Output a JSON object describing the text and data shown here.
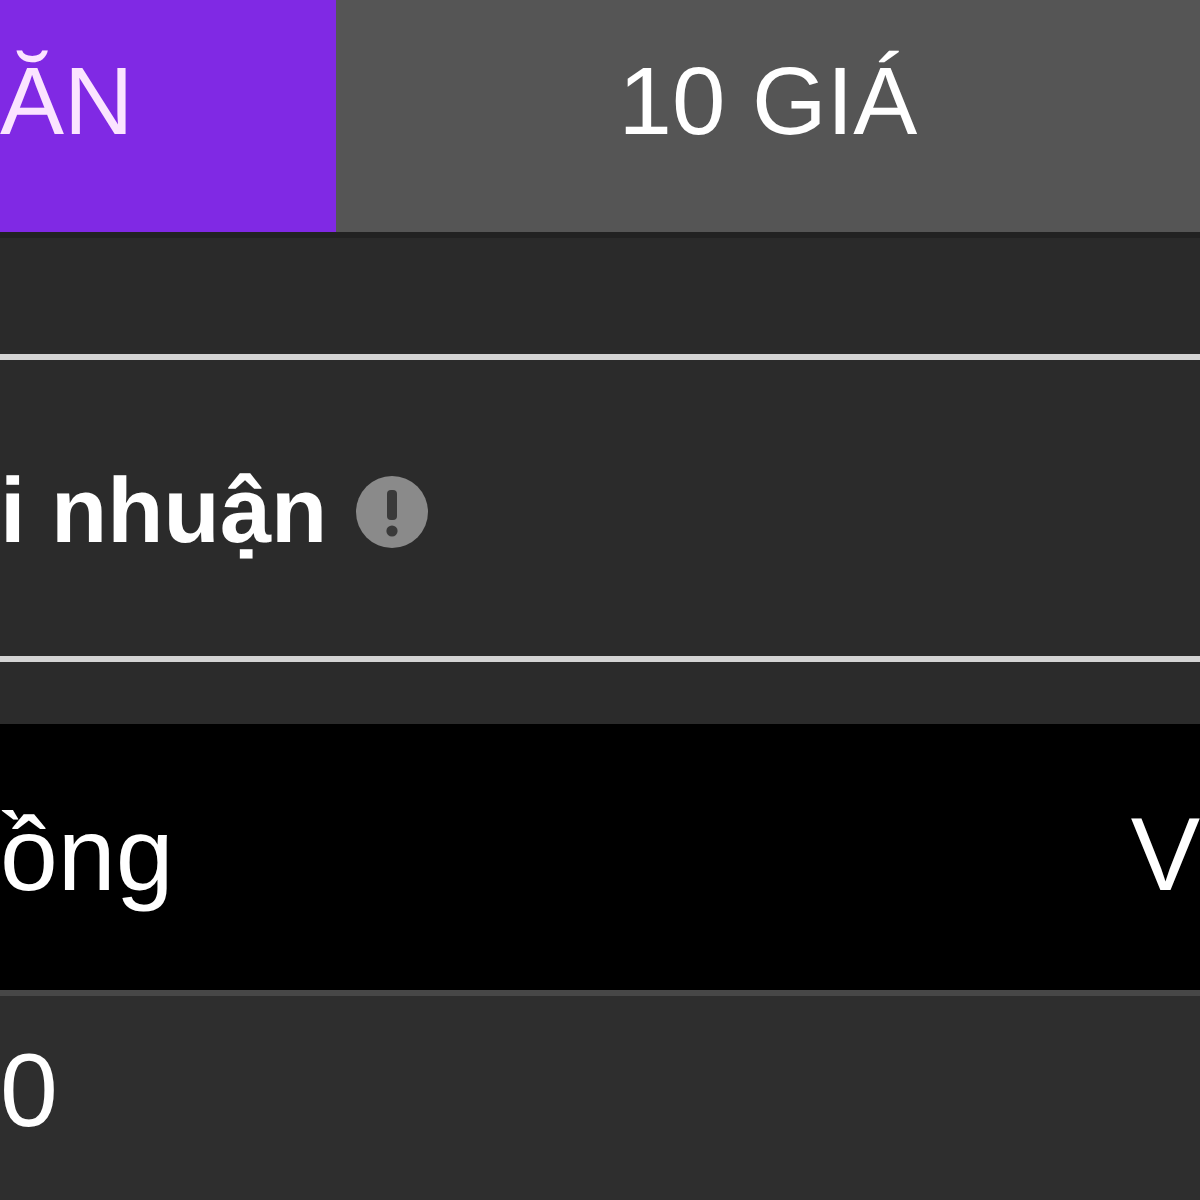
{
  "tabs": [
    {
      "label": "ĂN",
      "selected": true
    },
    {
      "label": "10 GIÁ",
      "selected": false
    }
  ],
  "section": {
    "title": "i nhuận"
  },
  "table": {
    "columns": [
      "ồng",
      "V"
    ],
    "rows": [
      [
        "0"
      ]
    ]
  }
}
